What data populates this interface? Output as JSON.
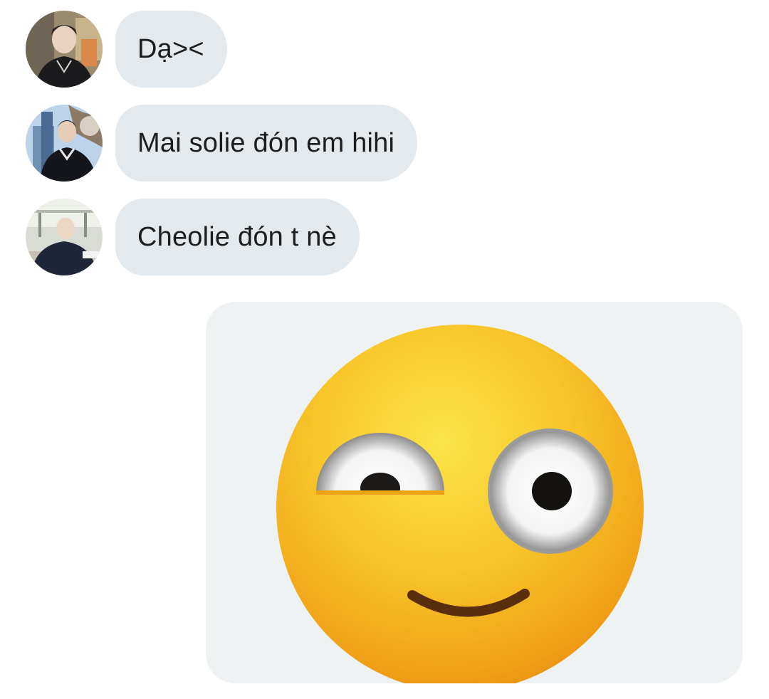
{
  "messages": [
    {
      "avatar": "user-avatar-1",
      "text": "Dạ><"
    },
    {
      "avatar": "user-avatar-2",
      "text": "Mai solie đón em hihi"
    },
    {
      "avatar": "user-avatar-3",
      "text": "Cheolie đón t nè"
    }
  ],
  "sticker": {
    "icon": "smirking-emoji-sticker"
  },
  "colors": {
    "bubble": "#e3e9ec",
    "text": "#1d1d1d",
    "emoji_face": "#f6b41e"
  }
}
